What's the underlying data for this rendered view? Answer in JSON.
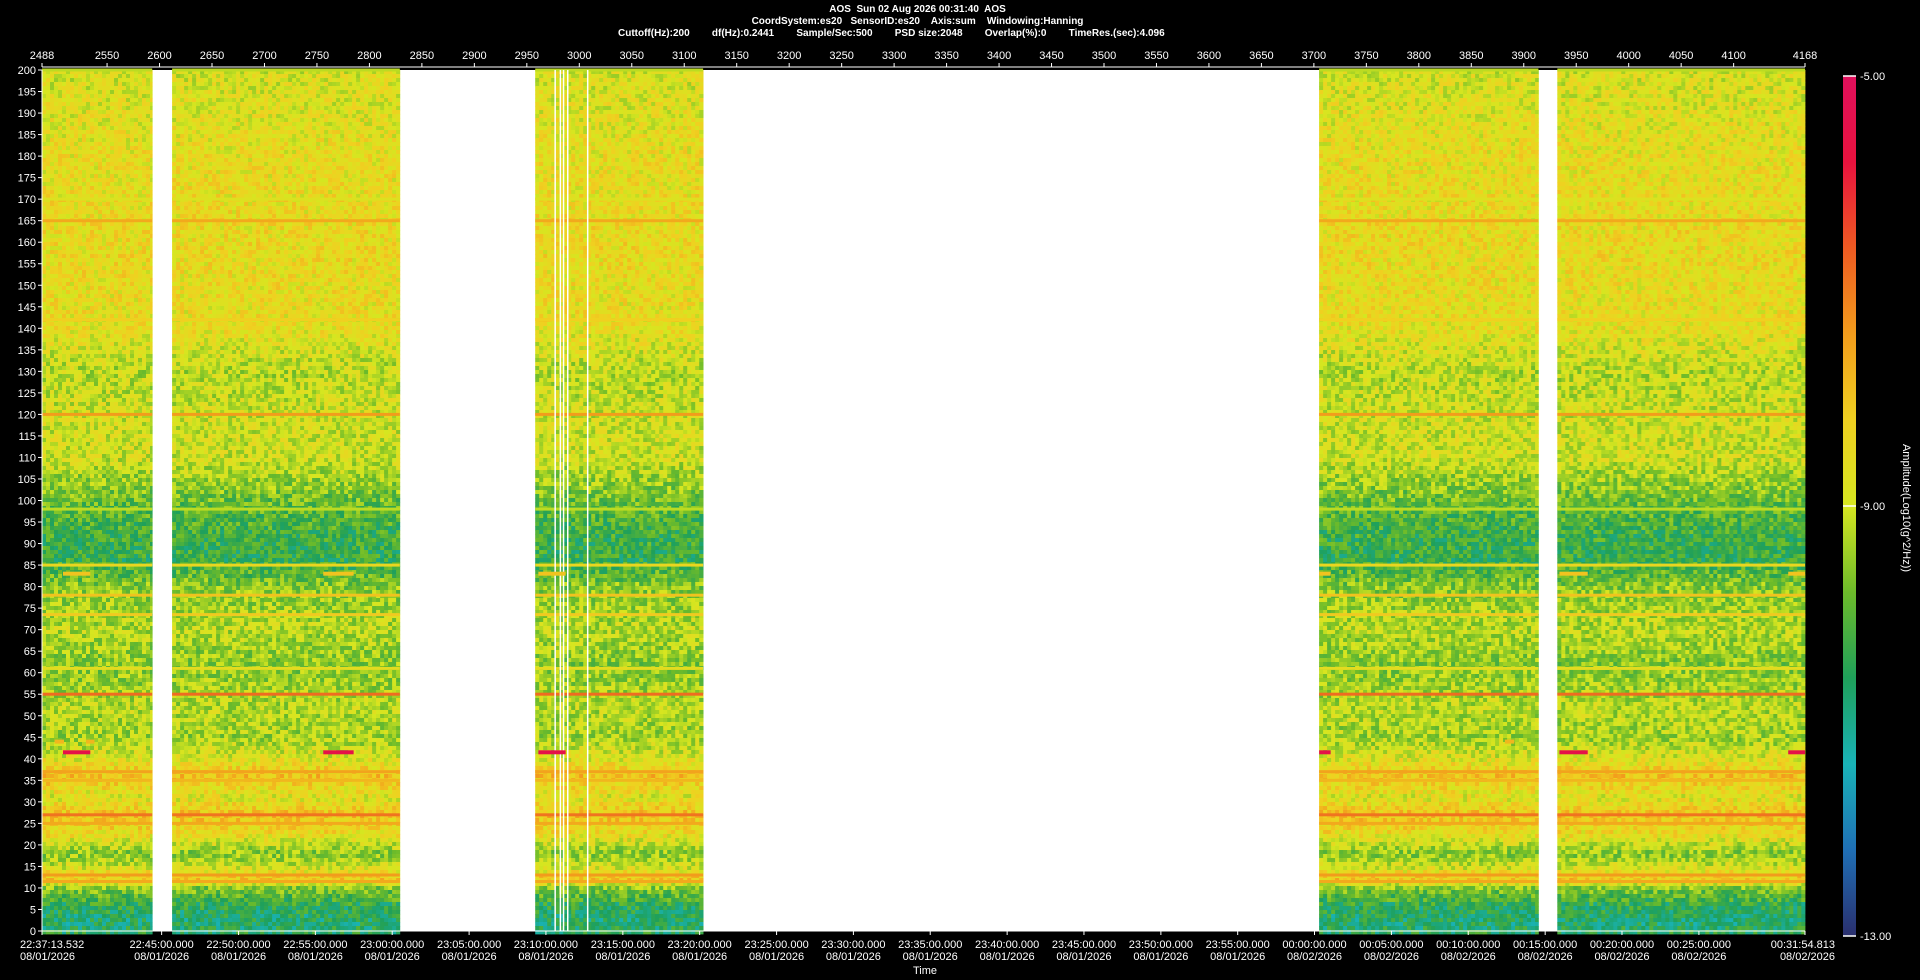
{
  "header": {
    "line1": "AOS  Sun 02 Aug 2026 00:31:40  AOS",
    "line2": "CoordSystem:es20   SensorID:es20    Axis:sum    Windowing:Hanning",
    "line3": "Cuttoff(Hz):200        df(Hz):0.2441        Sample/Sec:500        PSD size:2048        Overlap(%):0        TimeRes.(sec):4.096"
  },
  "chart_data": {
    "type": "heatmap",
    "title": "",
    "xlabel": "Time",
    "ylabel": "",
    "colorbar_label": "Amplitude(Log10(g^2/Hz))",
    "ylim": [
      0,
      200
    ],
    "yticks": [
      0,
      5,
      10,
      15,
      20,
      25,
      30,
      35,
      40,
      45,
      50,
      55,
      60,
      65,
      70,
      75,
      80,
      85,
      90,
      95,
      100,
      105,
      110,
      115,
      120,
      125,
      130,
      135,
      140,
      145,
      150,
      155,
      160,
      165,
      170,
      175,
      180,
      185,
      190,
      195,
      200
    ],
    "top_axis_range": [
      2488,
      4168
    ],
    "top_ticks": [
      "2488",
      "2550",
      "2600",
      "2650",
      "2700",
      "2750",
      "2800",
      "2850",
      "2900",
      "2950",
      "3000",
      "3050",
      "3100",
      "3150",
      "3200",
      "3250",
      "3300",
      "3350",
      "3400",
      "3450",
      "3500",
      "3550",
      "3600",
      "3650",
      "3700",
      "3750",
      "3800",
      "3850",
      "3900",
      "3950",
      "4000",
      "4050",
      "4100",
      "4168"
    ],
    "bottom_ticks": [
      {
        "time": "22:37:13.532",
        "date": "08/01/2026",
        "pos": 2488
      },
      {
        "time": "22:45:00.000",
        "date": "08/01/2026",
        "pos": 2602
      },
      {
        "time": "22:50:00.000",
        "date": "08/01/2026",
        "pos": 2675.3
      },
      {
        "time": "22:55:00.000",
        "date": "08/01/2026",
        "pos": 2748.5
      },
      {
        "time": "23:00:00.000",
        "date": "08/01/2026",
        "pos": 2821.7
      },
      {
        "time": "23:05:00.000",
        "date": "08/01/2026",
        "pos": 2895
      },
      {
        "time": "23:10:00.000",
        "date": "08/01/2026",
        "pos": 2968.2
      },
      {
        "time": "23:15:00.000",
        "date": "08/01/2026",
        "pos": 3041.5
      },
      {
        "time": "23:20:00.000",
        "date": "08/01/2026",
        "pos": 3114.7
      },
      {
        "time": "23:25:00.000",
        "date": "08/01/2026",
        "pos": 3188
      },
      {
        "time": "23:30:00.000",
        "date": "08/01/2026",
        "pos": 3261.2
      },
      {
        "time": "23:35:00.000",
        "date": "08/01/2026",
        "pos": 3334.4
      },
      {
        "time": "23:40:00.000",
        "date": "08/01/2026",
        "pos": 3407.7
      },
      {
        "time": "23:45:00.000",
        "date": "08/01/2026",
        "pos": 3480.9
      },
      {
        "time": "23:50:00.000",
        "date": "08/01/2026",
        "pos": 3554.2
      },
      {
        "time": "23:55:00.000",
        "date": "08/01/2026",
        "pos": 3627.4
      },
      {
        "time": "00:00:00.000",
        "date": "08/02/2026",
        "pos": 3700.6
      },
      {
        "time": "00:05:00.000",
        "date": "08/02/2026",
        "pos": 3773.9
      },
      {
        "time": "00:10:00.000",
        "date": "08/02/2026",
        "pos": 3847.1
      },
      {
        "time": "00:15:00.000",
        "date": "08/02/2026",
        "pos": 3920.4
      },
      {
        "time": "00:20:00.000",
        "date": "08/02/2026",
        "pos": 3993.6
      },
      {
        "time": "00:25:00.000",
        "date": "08/02/2026",
        "pos": 4066.9
      },
      {
        "time": "00:31:54.813",
        "date": "08/02/2026",
        "pos": 4168
      }
    ],
    "colorbar": {
      "range": [
        -13.0,
        -5.0
      ],
      "ticks": [
        "-5.00",
        "-9.00",
        "-13.00"
      ],
      "colors": [
        "#2a2f6e",
        "#1f6fb5",
        "#19b3b8",
        "#1fa05a",
        "#6dbb2a",
        "#d6e620",
        "#f0d020",
        "#f29c1c",
        "#ee5a22",
        "#e8123e",
        "#e0105c"
      ]
    },
    "data_segments": [
      [
        2488,
        2593
      ],
      [
        2612,
        2829
      ],
      [
        2958,
        3118
      ],
      [
        3705,
        3914
      ],
      [
        3932,
        4168
      ]
    ],
    "gap_lines": [
      2977,
      2982,
      2985,
      2989,
      3008
    ],
    "spectral_lines_hz": [
      {
        "hz": 200,
        "level": -9.2
      },
      {
        "hz": 170,
        "level": -8.8
      },
      {
        "hz": 165,
        "level": -7.6
      },
      {
        "hz": 142,
        "level": -8.2
      },
      {
        "hz": 120,
        "level": -7.4
      },
      {
        "hz": 98,
        "level": -9.2
      },
      {
        "hz": 85,
        "level": -8.4
      },
      {
        "hz": 78,
        "level": -8.0
      },
      {
        "hz": 73.5,
        "level": -8.1
      },
      {
        "hz": 61,
        "level": -8.6
      },
      {
        "hz": 55,
        "level": -6.8
      },
      {
        "hz": 37,
        "level": -7.5
      },
      {
        "hz": 35,
        "level": -7.8
      },
      {
        "hz": 27,
        "level": -6.9
      },
      {
        "hz": 25,
        "level": -7.6
      },
      {
        "hz": 13,
        "level": -7.4
      },
      {
        "hz": 11.5,
        "level": -7.6
      }
    ],
    "background_profile": [
      {
        "hz": 200,
        "level": -8.9
      },
      {
        "hz": 180,
        "level": -8.6
      },
      {
        "hz": 160,
        "level": -8.5
      },
      {
        "hz": 140,
        "level": -8.6
      },
      {
        "hz": 130,
        "level": -9.2
      },
      {
        "hz": 120,
        "level": -9.0
      },
      {
        "hz": 110,
        "level": -9.0
      },
      {
        "hz": 104,
        "level": -9.5
      },
      {
        "hz": 98,
        "level": -10.0
      },
      {
        "hz": 92,
        "level": -10.3
      },
      {
        "hz": 86,
        "level": -10.4
      },
      {
        "hz": 80,
        "level": -9.6
      },
      {
        "hz": 70,
        "level": -9.2
      },
      {
        "hz": 62,
        "level": -9.6
      },
      {
        "hz": 52,
        "level": -9.2
      },
      {
        "hz": 45,
        "level": -9.4
      },
      {
        "hz": 40,
        "level": -8.8
      },
      {
        "hz": 36,
        "level": -8.0
      },
      {
        "hz": 31,
        "level": -8.8
      },
      {
        "hz": 27,
        "level": -8.0
      },
      {
        "hz": 22,
        "level": -8.6
      },
      {
        "hz": 18,
        "level": -9.6
      },
      {
        "hz": 15,
        "level": -9.0
      },
      {
        "hz": 12,
        "level": -8.0
      },
      {
        "hz": 10,
        "level": -9.6
      },
      {
        "hz": 6,
        "level": -10.5
      },
      {
        "hz": 2,
        "level": -10.8
      },
      {
        "hz": 0,
        "level": -10.6
      }
    ],
    "events": [
      {
        "x0": 2508,
        "x1": 2534,
        "hz": 83,
        "level": -8.0
      },
      {
        "x0": 2756,
        "x1": 2785,
        "hz": 83,
        "level": -8.0
      },
      {
        "x0": 2961,
        "x1": 2987,
        "hz": 83,
        "level": -8.0
      },
      {
        "x0": 3705,
        "x1": 3716,
        "hz": 83,
        "level": -8.0
      },
      {
        "x0": 3934,
        "x1": 3961,
        "hz": 83,
        "level": -8.0
      },
      {
        "x0": 4152,
        "x1": 4168,
        "hz": 83,
        "level": -8.0
      },
      {
        "x0": 2508,
        "x1": 2534,
        "hz": 41.5,
        "level": -5.5
      },
      {
        "x0": 2756,
        "x1": 2785,
        "hz": 41.5,
        "level": -5.5
      },
      {
        "x0": 2961,
        "x1": 2987,
        "hz": 41.5,
        "level": -5.5
      },
      {
        "x0": 3705,
        "x1": 3716,
        "hz": 41.5,
        "level": -5.5
      },
      {
        "x0": 3934,
        "x1": 3961,
        "hz": 41.5,
        "level": -5.5
      },
      {
        "x0": 4152,
        "x1": 4168,
        "hz": 41.5,
        "level": -5.5
      },
      {
        "x0": 2500,
        "x1": 2509,
        "hz": 44,
        "level": -7.8
      },
      {
        "x0": 2530,
        "x1": 2538,
        "hz": 44,
        "level": -7.8
      },
      {
        "x0": 3882,
        "x1": 3891,
        "hz": 44,
        "level": -7.8
      }
    ]
  }
}
